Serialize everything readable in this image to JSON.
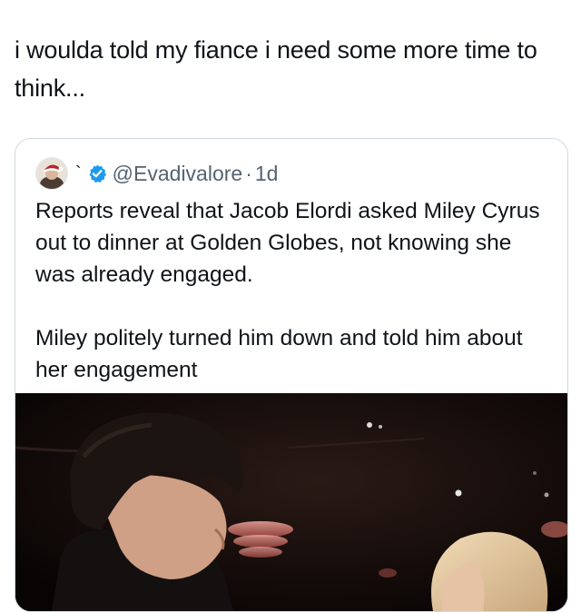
{
  "post": {
    "text": "i woulda told my fiance i need some more time to think..."
  },
  "quoted_post": {
    "display_name": "`",
    "handle": "@Evadivalore",
    "separator": "·",
    "time": "1d",
    "paragraph_1": "Reports reveal that Jacob Elordi asked Miley Cyrus out to dinner at Golden Globes, not knowing she was already engaged.",
    "paragraph_2": "Miley politely turned him down and told him about her engagement",
    "avatar_icon": "user-avatar-icon",
    "verified_icon": "verified-badge-icon",
    "verified_color": "#1d9bf0"
  },
  "colors": {
    "text": "#0f1419",
    "secondary_text": "#536471",
    "border": "#cfd9de"
  }
}
